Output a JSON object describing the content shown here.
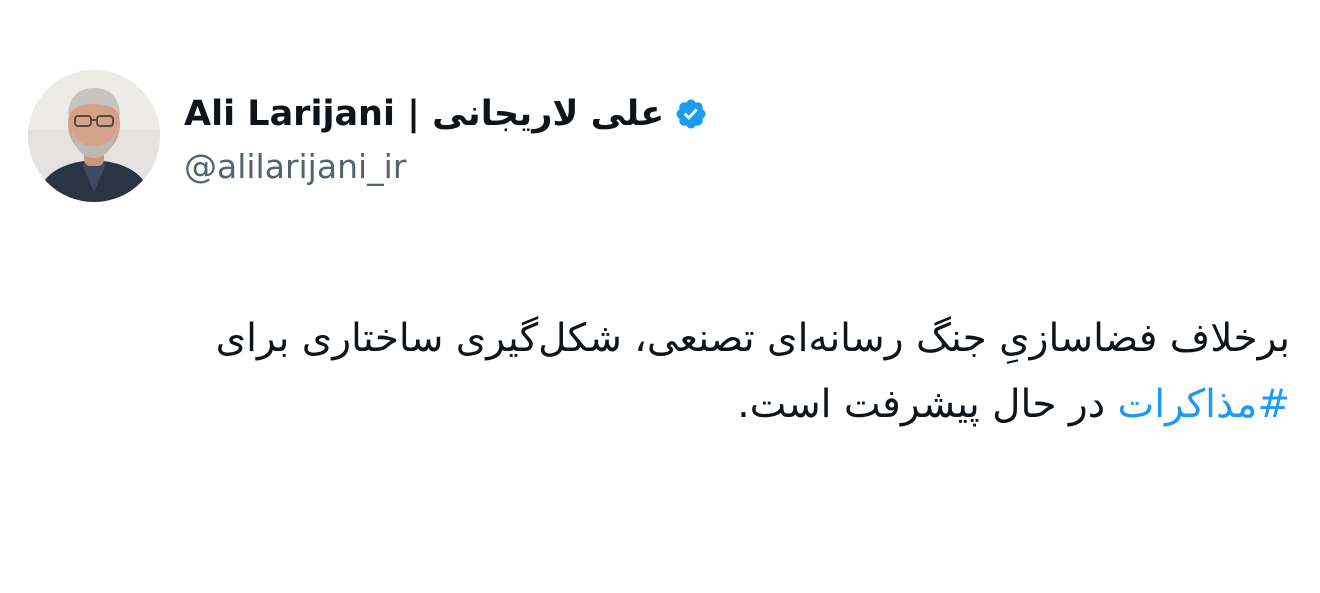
{
  "author": {
    "display_name": "Ali Larijani | علی لاریجانی",
    "handle": "@alilarijani_ir",
    "verified": true,
    "verified_icon": "verified-badge-icon",
    "avatar_icon": "profile-photo"
  },
  "tweet": {
    "text_before_hashtag": "برخلاف فضاسازیِ جنگ رسانه‌ای تصنعی، شکل‌گیری ساختاری برای ",
    "hashtag": "#مذاکرات",
    "text_after_hashtag": " در حال پیشرفت است."
  },
  "colors": {
    "accent": "#1d9bf0",
    "text_primary": "#0f1419",
    "text_secondary": "#536471",
    "background": "#ffffff"
  }
}
